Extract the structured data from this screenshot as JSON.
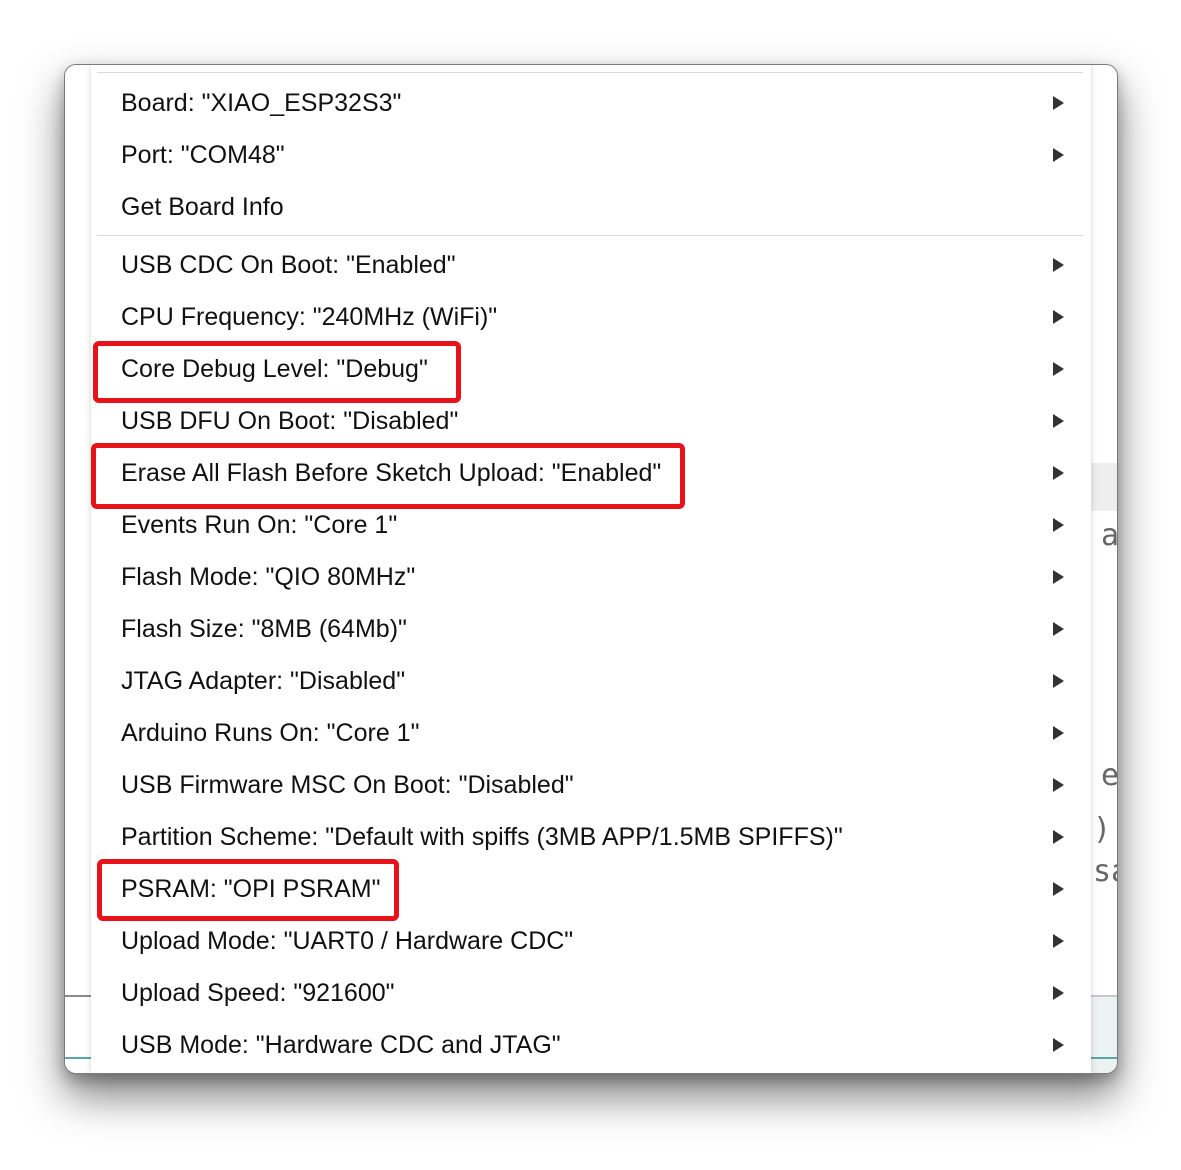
{
  "menu": {
    "items": [
      {
        "label": "Board: \"XIAO_ESP32S3\"",
        "submenu": true
      },
      {
        "label": "Port: \"COM48\"",
        "submenu": true
      },
      {
        "label": "Get Board Info",
        "submenu": false
      },
      {
        "label": "USB CDC On Boot: \"Enabled\"",
        "submenu": true
      },
      {
        "label": "CPU Frequency: \"240MHz (WiFi)\"",
        "submenu": true
      },
      {
        "label": "Core Debug Level: \"Debug\"",
        "submenu": true,
        "highlighted": true
      },
      {
        "label": "USB DFU On Boot: \"Disabled\"",
        "submenu": true
      },
      {
        "label": "Erase All Flash Before Sketch Upload: \"Enabled\"",
        "submenu": true,
        "highlighted": true
      },
      {
        "label": "Events Run On: \"Core 1\"",
        "submenu": true
      },
      {
        "label": "Flash Mode: \"QIO 80MHz\"",
        "submenu": true
      },
      {
        "label": "Flash Size: \"8MB (64Mb)\"",
        "submenu": true
      },
      {
        "label": "JTAG Adapter: \"Disabled\"",
        "submenu": true
      },
      {
        "label": "Arduino Runs On: \"Core 1\"",
        "submenu": true
      },
      {
        "label": "USB Firmware MSC On Boot: \"Disabled\"",
        "submenu": true
      },
      {
        "label": "Partition Scheme: \"Default with spiffs (3MB APP/1.5MB SPIFFS)\"",
        "submenu": true
      },
      {
        "label": "PSRAM: \"OPI PSRAM\"",
        "submenu": true,
        "highlighted": true
      },
      {
        "label": "Upload Mode: \"UART0 / Hardware CDC\"",
        "submenu": true
      },
      {
        "label": "Upload Speed: \"921600\"",
        "submenu": true
      },
      {
        "label": "USB Mode: \"Hardware CDC and JTAG\"",
        "submenu": true
      }
    ]
  },
  "background": {
    "right_glyphs": [
      "a",
      "e",
      ");",
      "sa"
    ]
  },
  "colors": {
    "highlight": "#e8121b",
    "text": "#111111",
    "separator": "#d8d8d8",
    "arrow": "#333333",
    "editor_accent": "#5aa6a8"
  }
}
